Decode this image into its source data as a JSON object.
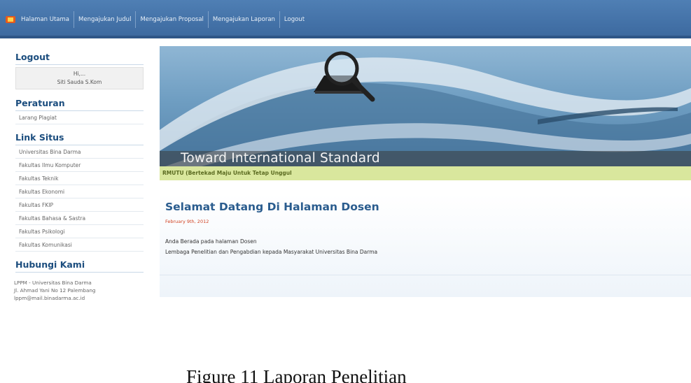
{
  "nav": {
    "items": [
      "Halaman Utama",
      "Mengajukan Judul",
      "Mengajukan Proposal",
      "Mengajukan Laporan",
      "Logout"
    ]
  },
  "sidebar": {
    "logout": {
      "title": "Logout",
      "greeting": "Hi,...",
      "user": "Siti Sauda S.Kom"
    },
    "peraturan": {
      "title": "Peraturan",
      "items": [
        "Larang Plagiat"
      ]
    },
    "link_situs": {
      "title": "Link Situs",
      "items": [
        "Universitas Bina Darma",
        "Fakultas Ilmu Komputer",
        "Fakultas Teknik",
        "Fakultas Ekonomi",
        "Fakultas FKIP",
        "Fakultas Bahasa & Sastra",
        "Fakultas Psikologi",
        "Fakultas Komunikasi"
      ]
    },
    "hubungi": {
      "title": "Hubungi Kami",
      "lines": [
        "LPPM - Universitas Bina Darma",
        "Jl. Ahmad Yani No 12 Palembang",
        "lppm@mail.binadarma.ac.id"
      ]
    }
  },
  "banner": {
    "title": "Toward International Standard",
    "tagline": "RMUTU (Bertekad Maju Untuk Tetap Unggul"
  },
  "main": {
    "title": "Selamat Datang Di Halaman Dosen",
    "date": "February 9th, 2012",
    "lines": [
      "Anda Berada pada halaman Dosen",
      "Lembaga Penelitian dan Pengabdian kepada Masyarakat Universitas Bina Darma"
    ]
  },
  "figure_caption": "Figure 11 Laporan Penelitian",
  "colors": {
    "nav_bg": "#4a79ae",
    "heading": "#1b4d7e",
    "tagline_bg": "#d9e79d",
    "date": "#d04020"
  }
}
